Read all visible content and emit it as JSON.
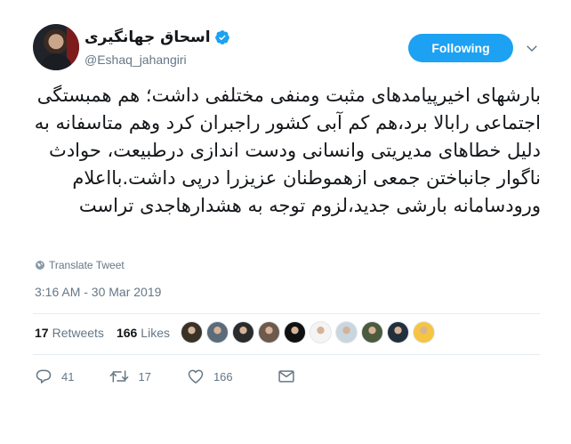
{
  "author": {
    "display_name": "اسحاق جهانگیری",
    "handle": "@Eshaq_jahangiri",
    "verified": true,
    "avatar_icon": "avatar-photo"
  },
  "follow_button": {
    "label": "Following",
    "color": "#1da1f2"
  },
  "menu": {
    "icon": "chevron-down-icon"
  },
  "tweet": {
    "text": "بارشهای اخیرپیامدهای مثبت ومنفی مختلفی داشت؛ هم همبستگی اجتماعی رابالا برد،هم کم آبی کشور راجبران کرد وهم متاسفانه به دلیل خطاهای مدیریتی وانسانی ودست اندازی درطبیعت، حوادث ناگوار جانباختن جمعی ازهموطنان عزیزرا درپی داشت.بااعلام ورودسامانه بارشی جدید،لزوم توجه به هشدارهاجدی تراست",
    "translate_label": "Translate Tweet",
    "timestamp": "3:16 AM - 30 Mar 2019"
  },
  "stats": {
    "retweets_count": "17",
    "retweets_label": "Retweets",
    "likes_count": "166",
    "likes_label": "Likes"
  },
  "likers": [
    {
      "icon": "liker-avatar-1",
      "color": "#3a3226"
    },
    {
      "icon": "liker-avatar-2",
      "color": "#5b6b7a"
    },
    {
      "icon": "liker-avatar-3",
      "color": "#2b2b2b"
    },
    {
      "icon": "liker-avatar-4",
      "color": "#6d5a4c"
    },
    {
      "icon": "liker-avatar-5",
      "color": "#111111"
    },
    {
      "icon": "liker-avatar-6",
      "color": "#f4f4f4"
    },
    {
      "icon": "liker-avatar-7",
      "color": "#c9d6de"
    },
    {
      "icon": "liker-avatar-8",
      "color": "#4c5a3e"
    },
    {
      "icon": "liker-avatar-9",
      "color": "#22303c"
    },
    {
      "icon": "liker-avatar-10",
      "color": "#f5c542"
    }
  ],
  "actions": {
    "reply_count": "41",
    "retweet_count": "17",
    "like_count": "166"
  }
}
